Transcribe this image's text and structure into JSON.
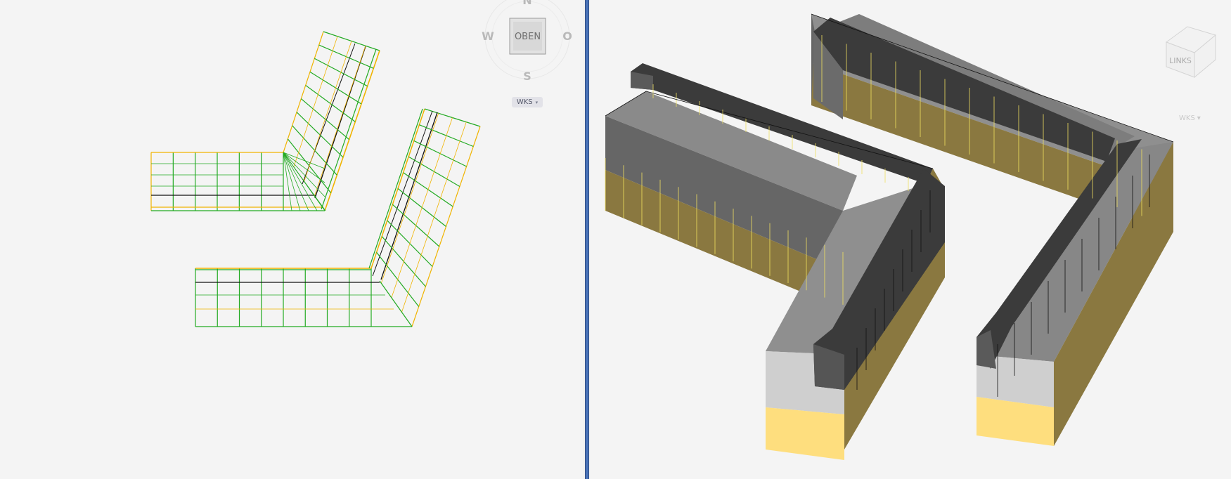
{
  "left_view": {
    "viewcube": {
      "face": "OBEN",
      "north": "N",
      "west": "W",
      "east": "O",
      "south": "S",
      "ucs_label": "WKS",
      "ucs_caret": "▾"
    }
  },
  "right_view": {
    "viewcube": {
      "face": "LINKS",
      "ucs_label": "WKS",
      "ucs_caret": "▾"
    }
  },
  "colors": {
    "background": "#f4f4f4",
    "splitter": "#4a73b8",
    "wire_green": "#22aa22",
    "wire_yellow": "#f0b400",
    "wire_black": "#111111",
    "solid_top_dark": "#3b3b3b",
    "solid_grey": "#8a8a8a",
    "solid_side_dark": "#666666",
    "solid_gold": "#8a7840",
    "solid_light_gold": "#fede7e",
    "solid_light_grey": "#cfcfcf"
  }
}
